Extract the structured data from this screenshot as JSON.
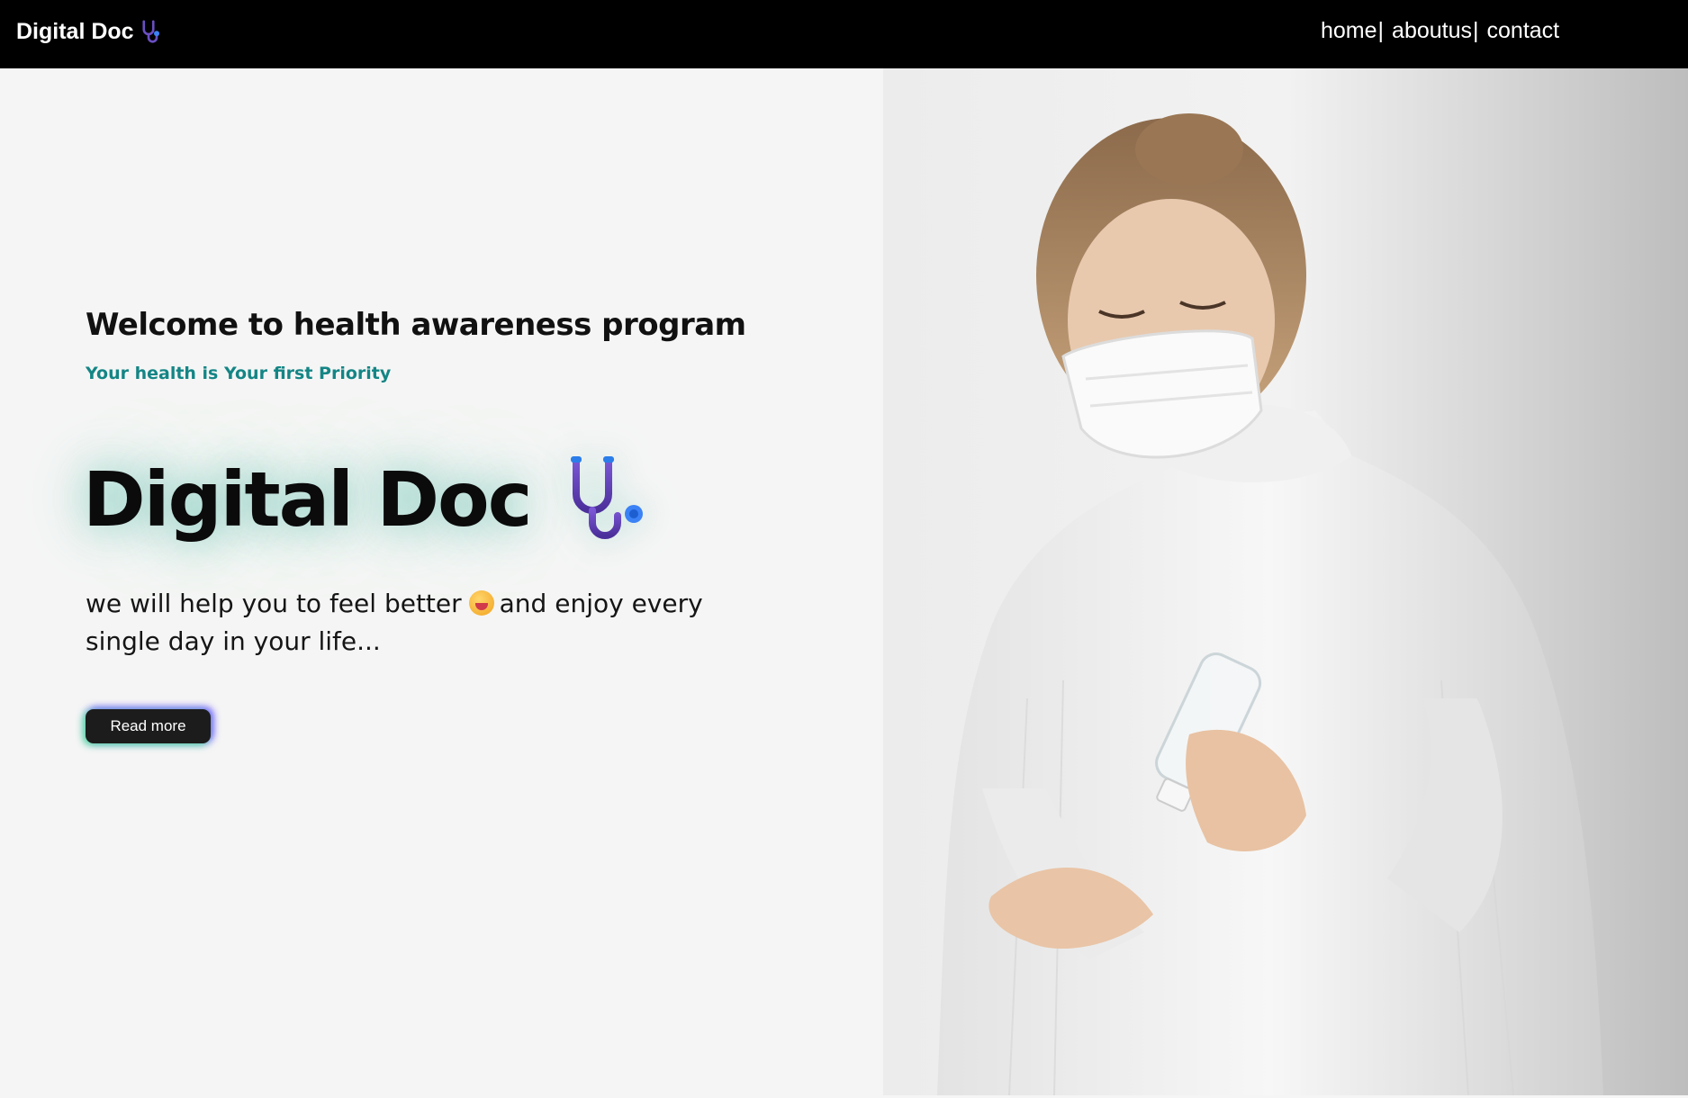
{
  "nav": {
    "brand": "Digital Doc",
    "brand_icon": "stethoscope-icon",
    "links": [
      {
        "label": "home",
        "sep": "|"
      },
      {
        "label": "aboutus",
        "sep": "|"
      },
      {
        "label": "contact",
        "sep": ""
      }
    ]
  },
  "hero": {
    "heading": "Welcome to health awareness program",
    "tagline": "Your health is Your first Priority",
    "title": "Digital Doc",
    "title_icon": "stethoscope-icon",
    "description_part1": "we will help you to feel better",
    "description_emoji": "grinning-face-icon",
    "description_part2": "and enjoy every single day in your life...",
    "button_label": "Read more",
    "image": "woman-with-mask-sanitizer-photo"
  },
  "colors": {
    "nav_background": "#000000",
    "tagline": "#148585",
    "button_background": "#1c1c1c",
    "stethoscope_purple": "#5b3fa8",
    "stethoscope_blue": "#3b82f6"
  }
}
